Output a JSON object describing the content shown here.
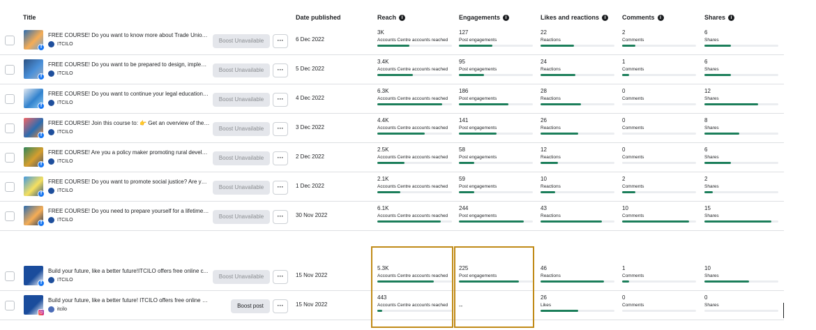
{
  "header": {
    "title": "Title",
    "date": "Date published",
    "reach": "Reach",
    "engagements": "Engagements",
    "likes": "Likes and reactions",
    "comments": "Comments",
    "shares": "Shares"
  },
  "colors": {
    "bar": "#1b7e5a",
    "highlight": "#c08a16"
  },
  "rows": [
    {
      "title": "FREE COURSE! Do you want to know more about Trade Unions,...",
      "page": "ITCILO",
      "platform": "facebook",
      "boost": "Boost Unavailable",
      "more": "···",
      "date": "6 Dec 2022",
      "reach": {
        "value": "3K",
        "label": "Accounts Centre accounts reached",
        "fill": 0.47
      },
      "engagements": {
        "value": "127",
        "label": "Post engagements",
        "fill": 0.5
      },
      "likes": {
        "value": "22",
        "label": "Reactions",
        "fill": 0.5
      },
      "comments": {
        "value": "2",
        "label": "Comments",
        "fill": 0.2
      },
      "shares": {
        "value": "6",
        "label": "Shares",
        "fill": 0.4
      }
    },
    {
      "title": "FREE COURSE! Do you want to be prepared to design, impleme...",
      "page": "ITCILO",
      "platform": "facebook",
      "boost": "Boost Unavailable",
      "more": "···",
      "date": "5 Dec 2022",
      "reach": {
        "value": "3.4K",
        "label": "Accounts Centre accounts reached",
        "fill": 0.53
      },
      "engagements": {
        "value": "95",
        "label": "Post engagements",
        "fill": 0.38
      },
      "likes": {
        "value": "24",
        "label": "Reactions",
        "fill": 0.52
      },
      "comments": {
        "value": "1",
        "label": "Comments",
        "fill": 0.1
      },
      "shares": {
        "value": "6",
        "label": "Shares",
        "fill": 0.4
      }
    },
    {
      "title": "FREE COURSE! Do you want to continue your legal education f...",
      "page": "ITCILO",
      "platform": "facebook",
      "boost": "Boost Unavailable",
      "more": "···",
      "date": "4 Dec 2022",
      "reach": {
        "value": "6.3K",
        "label": "Accounts Centre accounts reached",
        "fill": 0.96
      },
      "engagements": {
        "value": "186",
        "label": "Post engagements",
        "fill": 0.74
      },
      "likes": {
        "value": "28",
        "label": "Reactions",
        "fill": 0.6
      },
      "comments": {
        "value": "0",
        "label": "Comments",
        "fill": 0
      },
      "shares": {
        "value": "12",
        "label": "Shares",
        "fill": 0.8
      }
    },
    {
      "title": "FREE COURSE! Join this course to: 👉 Get an overview of the di...",
      "page": "ITCILO",
      "platform": "facebook",
      "boost": "Boost Unavailable",
      "more": "···",
      "date": "3 Dec 2022",
      "reach": {
        "value": "4.4K",
        "label": "Accounts Centre accounts reached",
        "fill": 0.7
      },
      "engagements": {
        "value": "141",
        "label": "Post engagements",
        "fill": 0.56
      },
      "likes": {
        "value": "26",
        "label": "Reactions",
        "fill": 0.56
      },
      "comments": {
        "value": "0",
        "label": "Comments",
        "fill": 0
      },
      "shares": {
        "value": "8",
        "label": "Shares",
        "fill": 0.52
      }
    },
    {
      "title": "FREE COURSE! Are you a policy maker promoting rural develop...",
      "page": "ITCILO",
      "platform": "facebook",
      "boost": "Boost Unavailable",
      "more": "···",
      "date": "2 Dec 2022",
      "reach": {
        "value": "2.5K",
        "label": "Accounts Centre accounts reached",
        "fill": 0.4
      },
      "engagements": {
        "value": "58",
        "label": "Post engagements",
        "fill": 0.23
      },
      "likes": {
        "value": "12",
        "label": "Reactions",
        "fill": 0.26
      },
      "comments": {
        "value": "0",
        "label": "Comments",
        "fill": 0
      },
      "shares": {
        "value": "6",
        "label": "Shares",
        "fill": 0.4
      }
    },
    {
      "title": "FREE COURSE! Do you want to promote social justice? Are you ...",
      "page": "ITCILO",
      "platform": "facebook",
      "boost": "Boost Unavailable",
      "more": "···",
      "date": "1 Dec 2022",
      "reach": {
        "value": "2.1K",
        "label": "Accounts Centre accounts reached",
        "fill": 0.34
      },
      "engagements": {
        "value": "59",
        "label": "Post engagements",
        "fill": 0.23
      },
      "likes": {
        "value": "10",
        "label": "Reactions",
        "fill": 0.22
      },
      "comments": {
        "value": "2",
        "label": "Comments",
        "fill": 0.2
      },
      "shares": {
        "value": "2",
        "label": "Shares",
        "fill": 0.13
      }
    },
    {
      "title": "FREE COURSE! Do you need to prepare yourself for a lifetime in...",
      "page": "ITCILO",
      "platform": "facebook",
      "boost": "Boost Unavailable",
      "more": "···",
      "date": "30 Nov 2022",
      "reach": {
        "value": "6.1K",
        "label": "Accounts Centre accounts reached",
        "fill": 0.94
      },
      "engagements": {
        "value": "244",
        "label": "Post engagements",
        "fill": 0.97
      },
      "likes": {
        "value": "43",
        "label": "Reactions",
        "fill": 0.92
      },
      "comments": {
        "value": "10",
        "label": "Comments",
        "fill": 1.0
      },
      "shares": {
        "value": "15",
        "label": "Shares",
        "fill": 1.0
      }
    },
    {
      "title": "Build your future, like a better future!ITCILO offers free online c...",
      "page": "ITCILO",
      "platform": "facebook",
      "boost": "Boost Unavailable",
      "more": "···",
      "date": "15 Nov 2022",
      "reach": {
        "value": "5.3K",
        "label": "Accounts Centre accounts reached",
        "fill": 0.84
      },
      "engagements": {
        "value": "225",
        "label": "Post engagements",
        "fill": 0.9
      },
      "likes": {
        "value": "46",
        "label": "Reactions",
        "fill": 0.95
      },
      "comments": {
        "value": "1",
        "label": "Comments",
        "fill": 0.1
      },
      "shares": {
        "value": "10",
        "label": "Shares",
        "fill": 0.67
      }
    },
    {
      "title": "Build your future, like a better future! ITCILO offers free online courses...",
      "page": "itcilo",
      "platform": "instagram",
      "boost": "Boost post",
      "more": "···",
      "date": "15 Nov 2022",
      "reach": {
        "value": "443",
        "label": "Accounts Centre accounts reached",
        "fill": 0.07
      },
      "engagements": {
        "value": "--",
        "label": "",
        "fill": -1
      },
      "likes": {
        "value": "26",
        "label": "Likes",
        "fill": 0.56
      },
      "comments": {
        "value": "0",
        "label": "Comments",
        "fill": 0
      },
      "shares": {
        "value": "0",
        "label": "Shares",
        "fill": 0
      }
    }
  ]
}
